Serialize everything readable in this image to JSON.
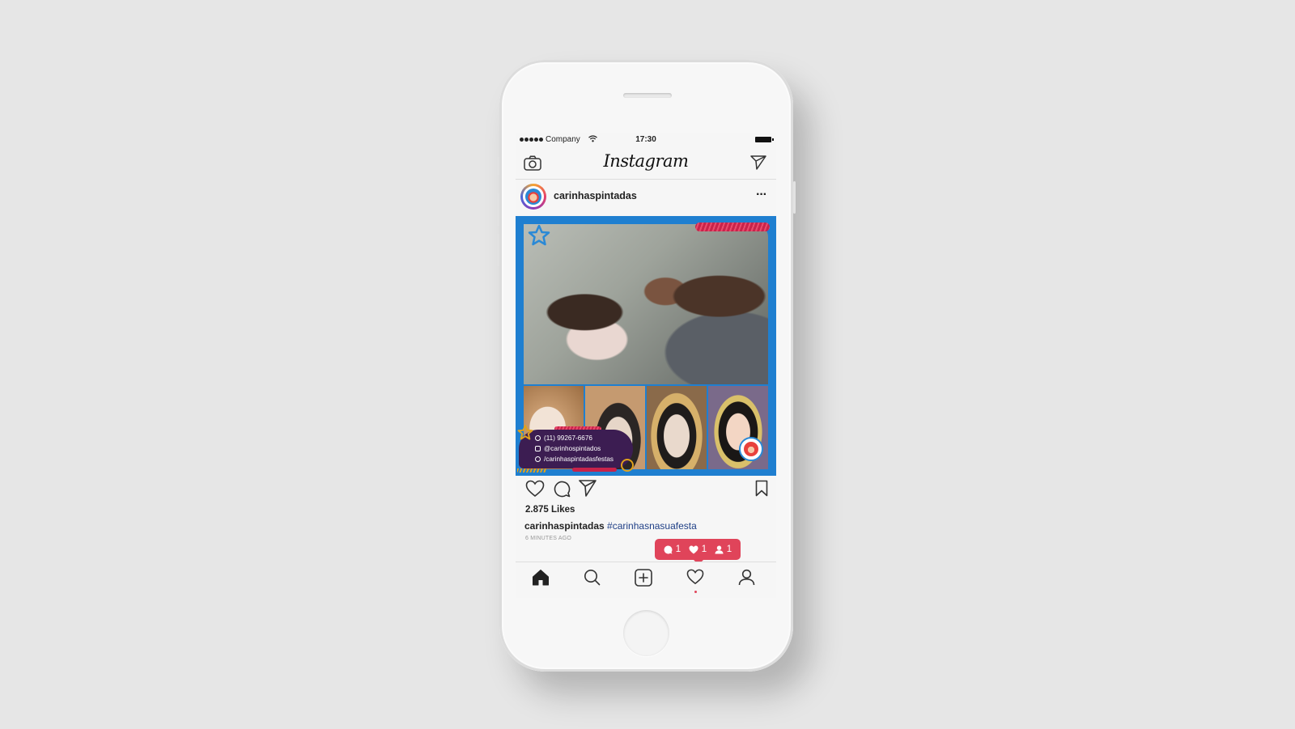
{
  "status_bar": {
    "carrier": "Company",
    "time": "17:30"
  },
  "app": {
    "brand": "Instagram"
  },
  "post": {
    "username": "carinhaspintadas",
    "more_label": "···",
    "contact": {
      "phone": "(11) 99267-6676",
      "instagram": "@carinhospintados",
      "facebook": "/carinhaspintadasfestas"
    },
    "likes": "2.875 Likes",
    "caption_user": "carinhaspintadas",
    "caption_tag": "#carinhasnasuafesta",
    "time_ago": "6 MINUTES AGO"
  },
  "notifications": {
    "comments": "1",
    "likes": "1",
    "follows": "1"
  },
  "colors": {
    "post_frame": "#1f7fd0",
    "notification": "#e0445a",
    "hashtag": "#1f3f86"
  }
}
